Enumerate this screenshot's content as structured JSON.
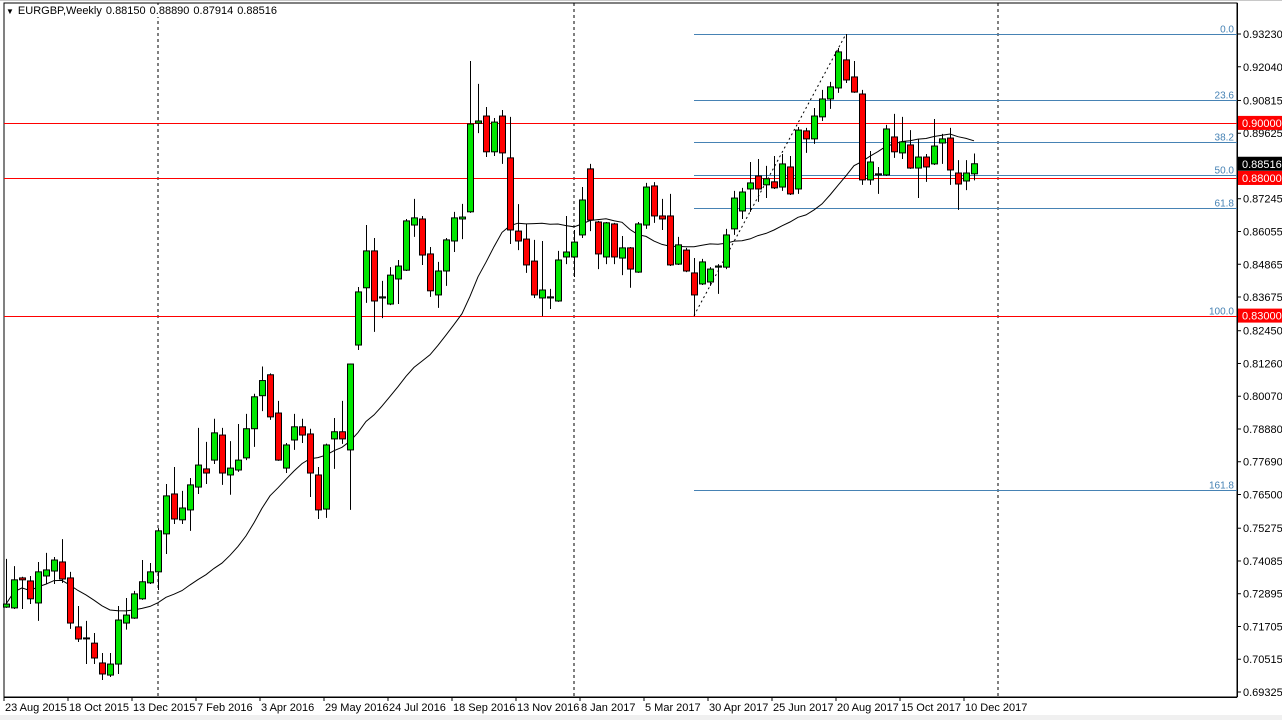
{
  "header": {
    "symbol": "EURGBP,Weekly",
    "open": "0.88150",
    "high": "0.88890",
    "low": "0.87914",
    "close": "0.88516"
  },
  "chart_data": {
    "type": "candlestick",
    "title": "EURGBP,Weekly",
    "timeframe": "Weekly",
    "ylim": [
      0.69325,
      0.9323
    ],
    "y_ticks": [
      "0.93230",
      "0.92040",
      "0.90815",
      "0.89625",
      "0.88435",
      "0.87245",
      "0.86055",
      "0.84865",
      "0.83675",
      "0.82450",
      "0.81260",
      "0.80070",
      "0.78880",
      "0.77690",
      "0.76500",
      "0.75275",
      "0.74085",
      "0.72895",
      "0.71705",
      "0.70515",
      "0.69325"
    ],
    "date_labels": [
      {
        "label": "23 Aug 2015",
        "index": 0
      },
      {
        "label": "18 Oct 2015",
        "index": 8
      },
      {
        "label": "13 Dec 2015",
        "index": 16
      },
      {
        "label": "7 Feb 2016",
        "index": 24
      },
      {
        "label": "3 Apr 2016",
        "index": 32
      },
      {
        "label": "29 May 2016",
        "index": 40
      },
      {
        "label": "24 Jul 2016",
        "index": 48
      },
      {
        "label": "18 Sep 2016",
        "index": 56
      },
      {
        "label": "13 Nov 2016",
        "index": 64
      },
      {
        "label": "8 Jan 2017",
        "index": 72
      },
      {
        "label": "5 Mar 2017",
        "index": 80
      },
      {
        "label": "30 Apr 2017",
        "index": 88
      },
      {
        "label": "25 Jun 2017",
        "index": 96
      },
      {
        "label": "20 Aug 2017",
        "index": 104
      },
      {
        "label": "15 Oct 2017",
        "index": 112
      },
      {
        "label": "10 Dec 2017",
        "index": 120
      }
    ],
    "period_separators": [
      19,
      71,
      124
    ],
    "ohlc_fields": [
      "open",
      "high",
      "low",
      "close"
    ],
    "candles": [
      [
        0.7241,
        0.7416,
        0.7238,
        0.7252
      ],
      [
        0.7238,
        0.739,
        0.7234,
        0.734
      ],
      [
        0.7347,
        0.7351,
        0.7234,
        0.734
      ],
      [
        0.7336,
        0.7354,
        0.7252,
        0.7271
      ],
      [
        0.7256,
        0.7405,
        0.7191,
        0.7369
      ],
      [
        0.7354,
        0.7438,
        0.7325,
        0.7376
      ],
      [
        0.7372,
        0.7423,
        0.7325,
        0.7412
      ],
      [
        0.7405,
        0.7488,
        0.7329,
        0.7343
      ],
      [
        0.7347,
        0.7369,
        0.7162,
        0.7183
      ],
      [
        0.7169,
        0.7245,
        0.7114,
        0.7125
      ],
      [
        0.7129,
        0.7191,
        0.7034,
        0.7127
      ],
      [
        0.711,
        0.7147,
        0.7034,
        0.7056
      ],
      [
        0.7038,
        0.7074,
        0.6976,
        0.6998
      ],
      [
        0.6994,
        0.7074,
        0.6987,
        0.7034
      ],
      [
        0.7034,
        0.7245,
        0.6998,
        0.7194
      ],
      [
        0.7183,
        0.7274,
        0.7159,
        0.7212
      ],
      [
        0.7201,
        0.73,
        0.7198,
        0.7289
      ],
      [
        0.7271,
        0.7412,
        0.7267,
        0.7333
      ],
      [
        0.7329,
        0.7401,
        0.7325,
        0.7369
      ],
      [
        0.7369,
        0.7528,
        0.7303,
        0.7518
      ],
      [
        0.7507,
        0.7688,
        0.7434,
        0.7645
      ],
      [
        0.7652,
        0.775,
        0.7543,
        0.7561
      ],
      [
        0.7558,
        0.7663,
        0.7543,
        0.7601
      ],
      [
        0.7594,
        0.771,
        0.7518,
        0.7685
      ],
      [
        0.7677,
        0.7892,
        0.7652,
        0.7757
      ],
      [
        0.7743,
        0.7841,
        0.7688,
        0.7728
      ],
      [
        0.7775,
        0.7925,
        0.7761,
        0.7874
      ],
      [
        0.7866,
        0.7892,
        0.7685,
        0.7728
      ],
      [
        0.7721,
        0.7844,
        0.7649,
        0.7746
      ],
      [
        0.7739,
        0.7906,
        0.7732,
        0.7775
      ],
      [
        0.7783,
        0.7943,
        0.7775,
        0.7889
      ],
      [
        0.7889,
        0.8016,
        0.7823,
        0.8005
      ],
      [
        0.8009,
        0.8115,
        0.7953,
        0.8064
      ],
      [
        0.8085,
        0.809,
        0.7921,
        0.7932
      ],
      [
        0.7946,
        0.799,
        0.7772,
        0.7775
      ],
      [
        0.7746,
        0.7837,
        0.7728,
        0.783
      ],
      [
        0.7848,
        0.7943,
        0.7812,
        0.7896
      ],
      [
        0.7896,
        0.7925,
        0.7837,
        0.7866
      ],
      [
        0.787,
        0.7889,
        0.7641,
        0.7728
      ],
      [
        0.7721,
        0.775,
        0.7561,
        0.7594
      ],
      [
        0.7597,
        0.7835,
        0.7565,
        0.783
      ],
      [
        0.7852,
        0.7928,
        0.7743,
        0.7878
      ],
      [
        0.7878,
        0.799,
        0.7834,
        0.7852
      ],
      [
        0.7812,
        0.8126,
        0.7594,
        0.8124
      ],
      [
        0.8193,
        0.8404,
        0.8175,
        0.8386
      ],
      [
        0.8401,
        0.8629,
        0.8346,
        0.8535
      ],
      [
        0.8535,
        0.8582,
        0.8241,
        0.8353
      ],
      [
        0.8364,
        0.8426,
        0.8291,
        0.8368
      ],
      [
        0.8342,
        0.8476,
        0.8338,
        0.8447
      ],
      [
        0.8433,
        0.8502,
        0.8342,
        0.848
      ],
      [
        0.8465,
        0.8651,
        0.8462,
        0.8644
      ],
      [
        0.8629,
        0.8724,
        0.8586,
        0.8655
      ],
      [
        0.8651,
        0.8662,
        0.8484,
        0.852
      ],
      [
        0.8524,
        0.8549,
        0.8368,
        0.839
      ],
      [
        0.8375,
        0.8495,
        0.8328,
        0.8462
      ],
      [
        0.8462,
        0.8582,
        0.8408,
        0.8575
      ],
      [
        0.8571,
        0.8677,
        0.8531,
        0.8655
      ],
      [
        0.8651,
        0.8706,
        0.8578,
        0.8658
      ],
      [
        0.8677,
        0.9225,
        0.8673,
        0.8996
      ],
      [
        0.8999,
        0.9142,
        0.8963,
        0.9007
      ],
      [
        0.9025,
        0.9058,
        0.8876,
        0.8895
      ],
      [
        0.8895,
        0.9018,
        0.888,
        0.9003
      ],
      [
        0.9025,
        0.9047,
        0.8851,
        0.8891
      ],
      [
        0.8873,
        0.9022,
        0.856,
        0.8611
      ],
      [
        0.8607,
        0.8705,
        0.8538,
        0.8571
      ],
      [
        0.8578,
        0.8633,
        0.8455,
        0.8484
      ],
      [
        0.8498,
        0.8575,
        0.8364,
        0.8375
      ],
      [
        0.8364,
        0.8571,
        0.8298,
        0.8393
      ],
      [
        0.8364,
        0.8397,
        0.8324,
        0.8368
      ],
      [
        0.8353,
        0.8535,
        0.835,
        0.8502
      ],
      [
        0.8513,
        0.8662,
        0.8487,
        0.8531
      ],
      [
        0.8513,
        0.8611,
        0.844,
        0.8567
      ],
      [
        0.8593,
        0.8767,
        0.8582,
        0.872
      ],
      [
        0.8833,
        0.8851,
        0.8607,
        0.8647
      ],
      [
        0.864,
        0.8644,
        0.8469,
        0.8524
      ],
      [
        0.8513,
        0.864,
        0.8487,
        0.8637
      ],
      [
        0.8633,
        0.8637,
        0.8487,
        0.8513
      ],
      [
        0.8509,
        0.8589,
        0.8447,
        0.8546
      ],
      [
        0.8546,
        0.8549,
        0.8401,
        0.8469
      ],
      [
        0.8458,
        0.864,
        0.8455,
        0.8633
      ],
      [
        0.8629,
        0.8782,
        0.8615,
        0.8767
      ],
      [
        0.8771,
        0.8785,
        0.8637,
        0.8662
      ],
      [
        0.8662,
        0.8724,
        0.8611,
        0.8651
      ],
      [
        0.8662,
        0.8742,
        0.848,
        0.8484
      ],
      [
        0.8487,
        0.8586,
        0.8484,
        0.8557
      ],
      [
        0.8538,
        0.8546,
        0.8458,
        0.8462
      ],
      [
        0.8455,
        0.8509,
        0.8298,
        0.8375
      ],
      [
        0.8415,
        0.8506,
        0.8411,
        0.8495
      ],
      [
        0.8422,
        0.8476,
        0.8408,
        0.8469
      ],
      [
        0.8476,
        0.8487,
        0.8379,
        0.848
      ],
      [
        0.8476,
        0.8615,
        0.8469,
        0.8593
      ],
      [
        0.8615,
        0.8753,
        0.8593,
        0.8727
      ],
      [
        0.868,
        0.8764,
        0.8651,
        0.8749
      ],
      [
        0.876,
        0.8858,
        0.8677,
        0.8782
      ],
      [
        0.8807,
        0.8869,
        0.8713,
        0.876
      ],
      [
        0.8775,
        0.8844,
        0.8727,
        0.8797
      ],
      [
        0.8786,
        0.888,
        0.876,
        0.8764
      ],
      [
        0.8767,
        0.8887,
        0.8753,
        0.8851
      ],
      [
        0.884,
        0.888,
        0.8738,
        0.8742
      ],
      [
        0.876,
        0.8985,
        0.8742,
        0.8974
      ],
      [
        0.8971,
        0.8982,
        0.8891,
        0.8942
      ],
      [
        0.8942,
        0.9054,
        0.8924,
        0.9025
      ],
      [
        0.9022,
        0.912,
        0.9007,
        0.9087
      ],
      [
        0.9087,
        0.9149,
        0.9051,
        0.9131
      ],
      [
        0.9127,
        0.9272,
        0.9109,
        0.9258
      ],
      [
        0.9229,
        0.9323,
        0.9145,
        0.9156
      ],
      [
        0.9167,
        0.9225,
        0.9109,
        0.9112
      ],
      [
        0.9105,
        0.912,
        0.8775,
        0.8793
      ],
      [
        0.8793,
        0.8898,
        0.8775,
        0.8858
      ],
      [
        0.8811,
        0.884,
        0.8742,
        0.8815
      ],
      [
        0.8811,
        0.8993,
        0.8807,
        0.8978
      ],
      [
        0.8949,
        0.9033,
        0.8873,
        0.8895
      ],
      [
        0.8891,
        0.9022,
        0.8869,
        0.8931
      ],
      [
        0.892,
        0.8974,
        0.8833,
        0.8836
      ],
      [
        0.8836,
        0.8942,
        0.8727,
        0.8876
      ],
      [
        0.8876,
        0.8887,
        0.8786,
        0.884
      ],
      [
        0.8851,
        0.9014,
        0.8847,
        0.8916
      ],
      [
        0.8927,
        0.896,
        0.8851,
        0.8942
      ],
      [
        0.8945,
        0.8982,
        0.8775,
        0.8829
      ],
      [
        0.8818,
        0.8865,
        0.8684,
        0.8778
      ],
      [
        0.8789,
        0.8865,
        0.8756,
        0.8818
      ],
      [
        0.8815,
        0.8889,
        0.87914,
        0.88516
      ]
    ],
    "moving_average_period": 20,
    "horizontal_levels": [
      {
        "price": 0.9,
        "label": "0.90000",
        "color": "#ff0000"
      },
      {
        "price": 0.88,
        "label": "0.88000",
        "color": "#ff0000"
      },
      {
        "price": 0.83,
        "label": "0.83000",
        "color": "#ff0000"
      }
    ],
    "current_price": {
      "price": 0.88516,
      "label": "0.88516",
      "color": "#000000"
    },
    "fibonacci": {
      "start_index": 86,
      "start_price": 0.83,
      "end_index": 105,
      "end_price": 0.9323,
      "color": "#4682b4",
      "levels": [
        {
          "ratio": 0.0,
          "label": "0.0"
        },
        {
          "ratio": 0.236,
          "label": "23.6"
        },
        {
          "ratio": 0.382,
          "label": "38.2"
        },
        {
          "ratio": 0.5,
          "label": "50.0"
        },
        {
          "ratio": 0.618,
          "label": "61.8"
        },
        {
          "ratio": 1.0,
          "label": "100.0"
        },
        {
          "ratio": 1.618,
          "label": "161.8"
        }
      ]
    },
    "colors": {
      "bull": "#00e600",
      "bear": "#ff0000",
      "outline": "#000000",
      "background": "#ffffff"
    }
  }
}
